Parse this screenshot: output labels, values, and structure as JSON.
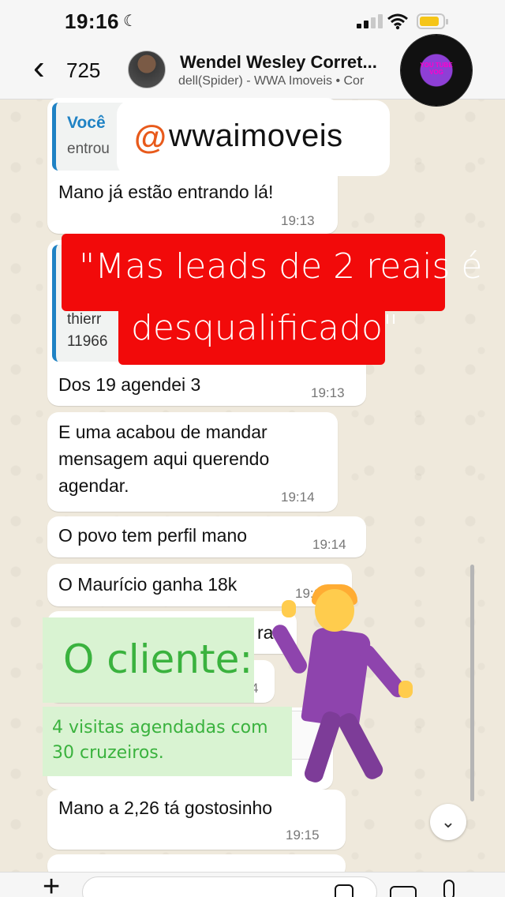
{
  "status_bar": {
    "time": "19:16",
    "moon_glyph": "☾",
    "battery_percent": 0.85
  },
  "header": {
    "back_glyph": "‹",
    "back_count": "725",
    "contact_name": "Wendel Wesley Corret...",
    "contact_subtitle": "dell(Spider) - WWA Imoveis  • Cor",
    "overlay_logo_text": "YOU TUBE VOG"
  },
  "overlays": {
    "threads_logo": "@",
    "threads_handle": "wwaimoveis",
    "red_line_1": "\"Mas leads de 2 reais é",
    "red_line_2": "desqualificado\"",
    "green_title": "O cliente:",
    "green_text": "4 visitas agendadas com 30 cruzeiros."
  },
  "messages": [
    {
      "quote_name": "Você",
      "quote_lines": [
        "entrou"
      ],
      "text": "Mano já estão entrando lá!",
      "time": "19:13"
    },
    {
      "quote_lines": [
        "thierr",
        "11966"
      ],
      "text": "Dos 19 agendei 3",
      "time": "19:13"
    },
    {
      "lines": [
        "E uma acabou de mandar",
        "mensagem aqui querendo",
        "agendar."
      ],
      "time": "19:14"
    },
    {
      "text": "O povo tem perfil mano",
      "time": "19:14"
    },
    {
      "text": "O Maurício ganha 18k",
      "time": "19:14"
    },
    {
      "partial_text": "rar"
    },
    {
      "partial_time": "4"
    },
    {
      "text": "Mano a 2,26  tá gostosinho",
      "time": "19:15"
    }
  ],
  "icons": {
    "scroll_down": "⌄",
    "composer_plus": "+",
    "wifi": "⌔"
  }
}
